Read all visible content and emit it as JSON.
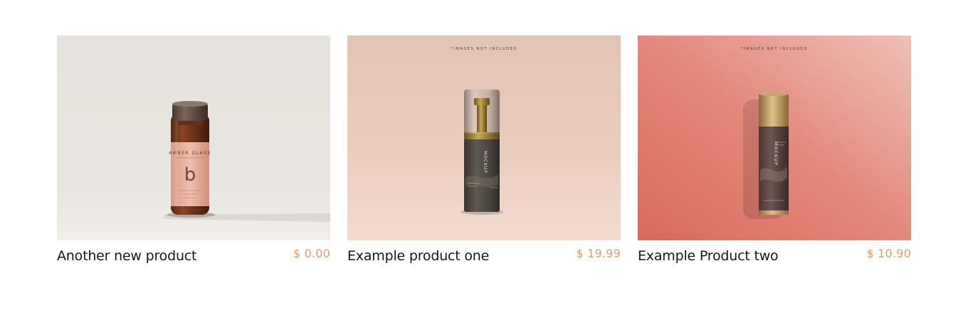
{
  "theme": {
    "price_color": "#e59a63",
    "text_color": "#161616"
  },
  "products": [
    {
      "title": "Another new product",
      "price": "$ 0.00",
      "image": {
        "icon": "amber-vial-bottle",
        "label_brand": "AMBER GLASS",
        "label_letter": "b",
        "overlay_text": ""
      }
    },
    {
      "title": "Example product one",
      "price": "$ 19.99",
      "image": {
        "icon": "airless-pump-bottle",
        "label_brand": "MOCKUP",
        "label_letter": "",
        "overlay_text": "*IMAGES NOT INCLUDED"
      }
    },
    {
      "title": "Example Product two",
      "price": "$ 10.90",
      "image": {
        "icon": "serum-tube-bottle",
        "label_brand": "MOCKUP",
        "label_letter": "",
        "overlay_text": "*IMAGES NOT INCLUDED"
      }
    }
  ]
}
